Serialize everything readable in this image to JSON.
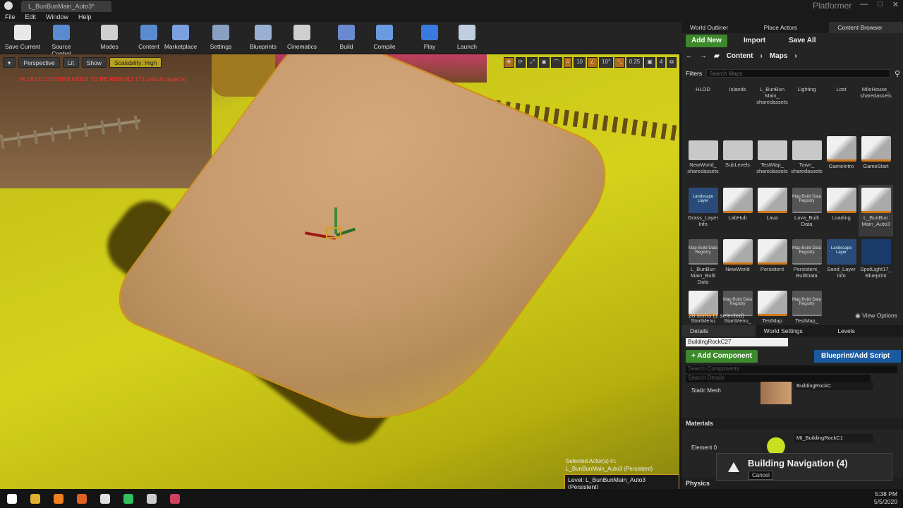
{
  "window": {
    "doc_tab": "L_BunBunMain_Auto3*",
    "project": "Platformer",
    "controls": [
      "—",
      "□",
      "✕"
    ]
  },
  "menu": [
    "File",
    "Edit",
    "Window",
    "Help"
  ],
  "toolbar": [
    {
      "label": "Save Current",
      "icon": "save-icon",
      "color": "#e8e8e8"
    },
    {
      "label": "Source Control",
      "icon": "source-control-icon",
      "color": "#5a8ad0"
    },
    {
      "label": "Modes",
      "icon": "modes-icon",
      "color": "#cfcfcf"
    },
    {
      "label": "Content",
      "icon": "content-icon",
      "color": "#5a8ad0"
    },
    {
      "label": "Marketplace",
      "icon": "marketplace-icon",
      "color": "#7aa0e0"
    },
    {
      "label": "Settings",
      "icon": "settings-icon",
      "color": "#8aa0c0"
    },
    {
      "label": "Blueprints",
      "icon": "blueprints-icon",
      "color": "#9ab0d0"
    },
    {
      "label": "Cinematics",
      "icon": "cinematics-icon",
      "color": "#cfcfcf"
    },
    {
      "label": "Build",
      "icon": "build-icon",
      "color": "#6a8ad0"
    },
    {
      "label": "Compile",
      "icon": "compile-icon",
      "color": "#6a9ae0"
    },
    {
      "label": "Play",
      "icon": "play-icon",
      "color": "#3a7ae0"
    },
    {
      "label": "Launch",
      "icon": "launch-icon",
      "color": "#bfcfe0"
    }
  ],
  "viewport": {
    "perspective": "Perspective",
    "lit": "Lit",
    "show": "Show",
    "scalability": "Scalability: High",
    "right_controls": [
      "10",
      "10°",
      "0.25",
      "4"
    ],
    "warning": "HLOD CLUSTERS NEED TO BE REBUILT (72 unbuilt objects)",
    "selected_info_1": "Selected Actor(s) in:",
    "selected_info_2": "L_BunBunMain_Auto3 (Persistent)",
    "level_badge": "Level:  L_BunBunMain_Auto3 (Persistent)"
  },
  "right_tabs": [
    "World Outliner",
    "Place Actors",
    "Content Browser"
  ],
  "content_browser": {
    "add_new": "Add New",
    "import": "Import",
    "save_all": "Save All",
    "path": [
      "Content",
      "Maps"
    ],
    "filters": "Filters",
    "search_placeholder": "Search Maps",
    "items": [
      {
        "name": "HLOD",
        "kind": "text"
      },
      {
        "name": "Islands",
        "kind": "text"
      },
      {
        "name": "L_BunBun Main_ sharedassets",
        "kind": "text"
      },
      {
        "name": "Lighting",
        "kind": "text"
      },
      {
        "name": "Lost",
        "kind": "text"
      },
      {
        "name": "MiloHouse_ sharedassets",
        "kind": "text"
      },
      {
        "name": "NewWorld_ sharedassets",
        "kind": "folder"
      },
      {
        "name": "SubLevels",
        "kind": "folder"
      },
      {
        "name": "TestMap_ sharedassets",
        "kind": "folder"
      },
      {
        "name": "Town_ sharedassets",
        "kind": "folder"
      },
      {
        "name": "GameIntro",
        "kind": "map"
      },
      {
        "name": "GameStart",
        "kind": "map"
      },
      {
        "name": "Grass_Layer Info",
        "kind": "land",
        "thumb": "Landscape Layer"
      },
      {
        "name": "LabHub",
        "kind": "map"
      },
      {
        "name": "Lava",
        "kind": "map"
      },
      {
        "name": "Lava_Built Data",
        "kind": "reg",
        "thumb": "Map Build Data Registry"
      },
      {
        "name": "Loading",
        "kind": "map"
      },
      {
        "name": "L_BunBun Main_Auto3",
        "kind": "map",
        "selected": true
      },
      {
        "name": "L_BunBun Main_Built Data",
        "kind": "reg",
        "thumb": "Map Build Data Registry"
      },
      {
        "name": "NewWorld",
        "kind": "map"
      },
      {
        "name": "Persistent",
        "kind": "map"
      },
      {
        "name": "Persistent_ BuiltData",
        "kind": "reg",
        "thumb": "Map Build Data Registry"
      },
      {
        "name": "Sand_Layer Info",
        "kind": "land",
        "thumb": "Landscape Layer"
      },
      {
        "name": "SpotLight17_ Blueprint",
        "kind": "bp"
      },
      {
        "name": "StartMenu",
        "kind": "map"
      },
      {
        "name": "StartMenu_ BuiltData",
        "kind": "reg",
        "thumb": "Map Build Data Registry"
      },
      {
        "name": "TestMap",
        "kind": "map"
      },
      {
        "name": "TestMap_ BuiltData",
        "kind": "reg",
        "thumb": "Map Build Data Registry"
      }
    ],
    "count": "28 items (1 selected)",
    "view_options": "View Options"
  },
  "details_tabs": [
    "Details",
    "World Settings",
    "Levels"
  ],
  "details": {
    "actor_name": "BuildingRockC27",
    "add_component": "+ Add Component",
    "blueprint_script": "Blueprint/Add Script",
    "search_components": "Search Components",
    "search_details": "Search Details",
    "static_mesh_label": "Static Mesh",
    "static_mesh_value": "BuildingRockC",
    "materials_section": "Materials",
    "element0_label": "Element 0",
    "element0_value": "MI_BuildingRockC1",
    "physics_section": "Physics"
  },
  "toast": {
    "title": "Building Navigation (4)",
    "cancel": "Cancel"
  },
  "taskbar": {
    "icons": [
      {
        "name": "windows-start-icon",
        "color": "#ffffff"
      },
      {
        "name": "chrome-icon",
        "color": "#e0b030"
      },
      {
        "name": "firefox-icon",
        "color": "#f08020"
      },
      {
        "name": "blender-icon",
        "color": "#e06020"
      },
      {
        "name": "unreal-icon",
        "color": "#e0e0e0"
      },
      {
        "name": "headset-icon",
        "color": "#30c060"
      },
      {
        "name": "obs-icon",
        "color": "#cccccc"
      },
      {
        "name": "app-icon",
        "color": "#d04060"
      }
    ],
    "time": "5:38 PM",
    "date": "5/5/2020"
  }
}
